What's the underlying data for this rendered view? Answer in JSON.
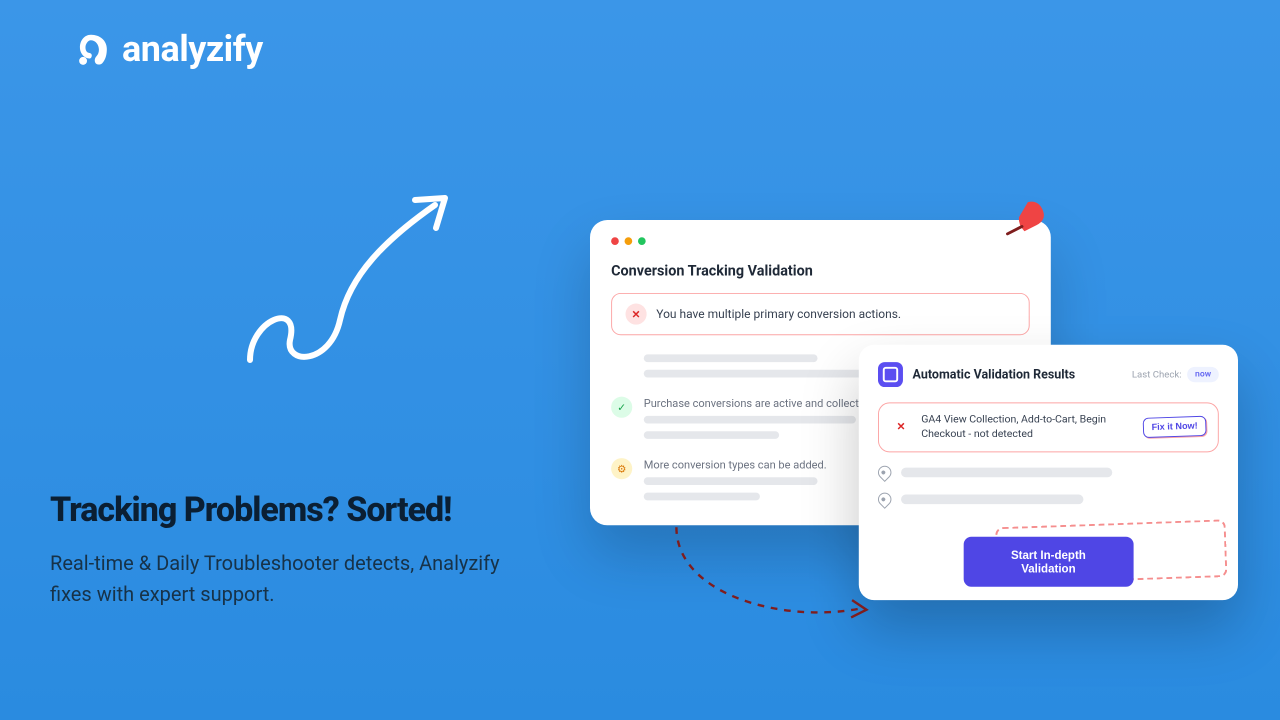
{
  "brand": {
    "name": "analyzify"
  },
  "hero": {
    "headline": "Tracking Problems? Sorted!",
    "subtext": "Real-time & Daily Troubleshooter detects, Analyzify fixes with expert support."
  },
  "card_left": {
    "title": "Conversion Tracking Validation",
    "error_message": "You have multiple primary conversion actions.",
    "rows": [
      {
        "text": "Purchase conversions are active and collected"
      },
      {
        "text": "More conversion types can be added."
      }
    ]
  },
  "card_right": {
    "title": "Automatic Validation Results",
    "last_check_label": "Last Check:",
    "last_check_value": "now",
    "error_message": "GA4 View Collection, Add-to-Cart, Begin Checkout - not detected",
    "fix_button": "Fix it Now!",
    "cta": "Start In-depth Validation"
  }
}
